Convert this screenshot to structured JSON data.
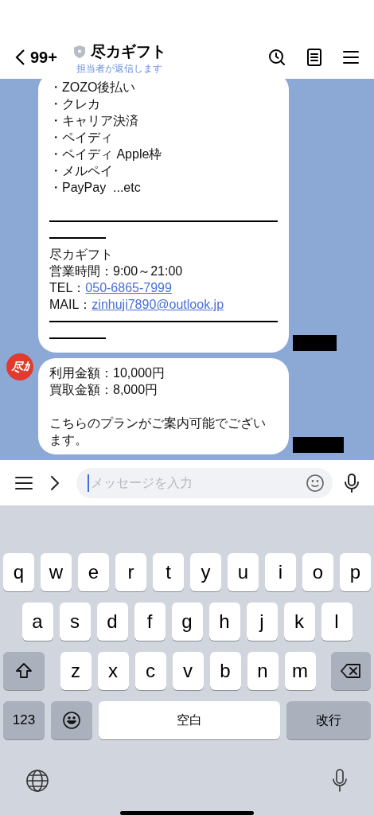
{
  "header": {
    "back_count": "99+",
    "title": "尽カギフト",
    "subtitle": "担当者が返信します"
  },
  "messages": [
    {
      "lines": [
        {
          "kind": "text",
          "text": "・ZOZO後払い"
        },
        {
          "kind": "text",
          "text": "・クレカ"
        },
        {
          "kind": "text",
          "text": "・キャリア決済"
        },
        {
          "kind": "text",
          "text": "・ペイディ"
        },
        {
          "kind": "text",
          "text": "・ペイディ Apple枠"
        },
        {
          "kind": "text",
          "text": "・メルペイ"
        },
        {
          "kind": "text",
          "text": "・PayPay  ...etc"
        },
        {
          "kind": "blank"
        },
        {
          "kind": "long_rule"
        },
        {
          "kind": "short_rule"
        },
        {
          "kind": "text",
          "text": "尽カギフト"
        },
        {
          "kind": "text",
          "text": "営業時間：9:00～21:00"
        },
        {
          "kind": "link_line",
          "label": "TEL：",
          "link": "050-6865-7999"
        },
        {
          "kind": "link_line",
          "label": "MAIL：",
          "link": "zinhuji7890@outlook.jp"
        },
        {
          "kind": "long_rule"
        },
        {
          "kind": "short_rule"
        }
      ]
    },
    {
      "avatar": "尽ｶ",
      "lines": [
        {
          "kind": "text",
          "text": "利用金額：10,000円"
        },
        {
          "kind": "text",
          "text": "買取金額：8,000円"
        },
        {
          "kind": "blank"
        },
        {
          "kind": "text",
          "text": "こちらのプランがご案内可能でございます。"
        }
      ]
    }
  ],
  "composer": {
    "placeholder": "メッセージを入力"
  },
  "keyboard": {
    "rows": [
      [
        "q",
        "w",
        "e",
        "r",
        "t",
        "y",
        "u",
        "i",
        "o",
        "p"
      ],
      [
        "a",
        "s",
        "d",
        "f",
        "g",
        "h",
        "j",
        "k",
        "l"
      ],
      [
        "z",
        "x",
        "c",
        "v",
        "b",
        "n",
        "m"
      ]
    ],
    "numbers_key": "123",
    "space_key": "空白",
    "return_key": "改行"
  }
}
